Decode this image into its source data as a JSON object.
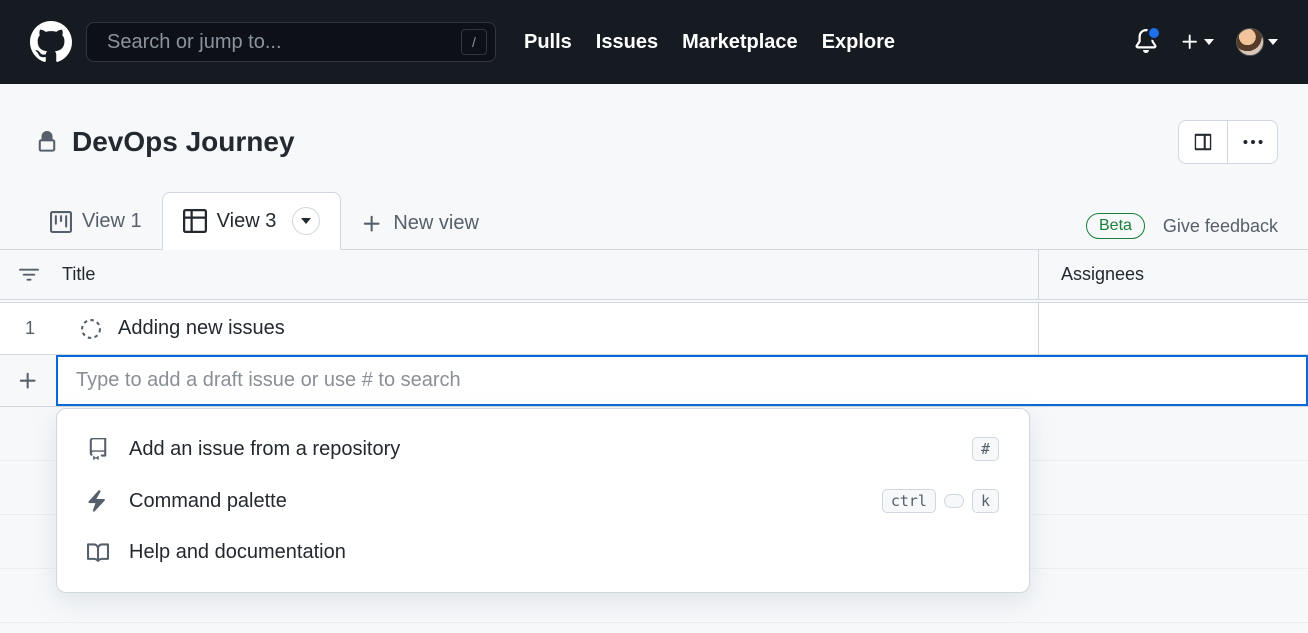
{
  "nav": {
    "search_placeholder": "Search or jump to...",
    "slash": "/",
    "links": [
      "Pulls",
      "Issues",
      "Marketplace",
      "Explore"
    ]
  },
  "project": {
    "title": "DevOps Journey"
  },
  "tabs": {
    "view1": "View 1",
    "view3": "View 3",
    "new_view": "New view",
    "beta": "Beta",
    "feedback": "Give feedback"
  },
  "table": {
    "header_title": "Title",
    "header_assignees": "Assignees",
    "rows": [
      {
        "num": "1",
        "title": "Adding new issues"
      }
    ],
    "add_placeholder": "Type to add a draft issue or use # to search"
  },
  "popup": {
    "add_from_repo": "Add an issue from a repository",
    "add_from_repo_key": "#",
    "command_palette": "Command palette",
    "command_palette_keys": [
      "ctrl",
      "k"
    ],
    "help": "Help and documentation"
  }
}
